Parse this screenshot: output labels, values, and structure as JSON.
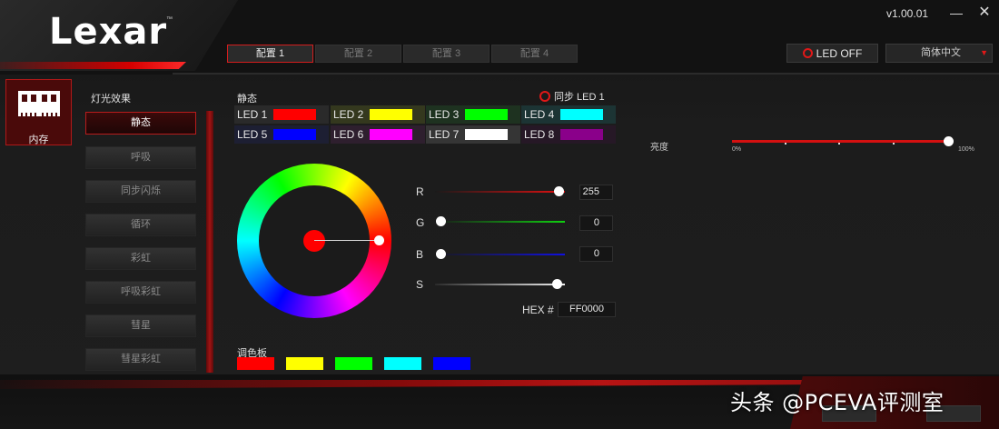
{
  "app": {
    "brand": "Lexar",
    "trademark": "™",
    "version": "v1.00.01",
    "window_min": "—",
    "window_close": "✕"
  },
  "tabs": [
    {
      "label": "配置 1",
      "active": true
    },
    {
      "label": "配置 2",
      "active": false
    },
    {
      "label": "配置 3",
      "active": false
    },
    {
      "label": "配置 4",
      "active": false
    }
  ],
  "header": {
    "led_off_label": "LED OFF",
    "language": "简体中文",
    "language_arrow": "▼"
  },
  "device": {
    "label": "内存",
    "icon": "ram-module-icon"
  },
  "effects": {
    "title": "灯光效果",
    "items": [
      {
        "label": "静态",
        "active": true
      },
      {
        "label": "呼吸",
        "active": false
      },
      {
        "label": "同步闪烁",
        "active": false
      },
      {
        "label": "循环",
        "active": false
      },
      {
        "label": "彩虹",
        "active": false
      },
      {
        "label": "呼吸彩虹",
        "active": false
      },
      {
        "label": "彗星",
        "active": false
      },
      {
        "label": "彗星彩虹",
        "active": false
      }
    ]
  },
  "static": {
    "title": "静态",
    "sync_label": "同步 LED 1",
    "leds": [
      {
        "label": "LED 1",
        "color": "#ff0000",
        "bg": "#2a2a2a"
      },
      {
        "label": "LED 2",
        "color": "#ffff00",
        "bg": "#34381e"
      },
      {
        "label": "LED 3",
        "color": "#00ff00",
        "bg": "#1e3220"
      },
      {
        "label": "LED 4",
        "color": "#00ffff",
        "bg": "#1c3434"
      },
      {
        "label": "LED 5",
        "color": "#0000ff",
        "bg": "#1d1f33"
      },
      {
        "label": "LED 6",
        "color": "#ff00ff",
        "bg": "#2e1f2e"
      },
      {
        "label": "LED 7",
        "color": "#ffffff",
        "bg": "#353535"
      },
      {
        "label": "LED 8",
        "color": "#8a008a",
        "bg": "#261826"
      }
    ]
  },
  "color": {
    "r_label": "R",
    "r_value": "255",
    "g_label": "G",
    "g_value": "0",
    "b_label": "B",
    "b_value": "0",
    "s_label": "S",
    "hex_label": "HEX #",
    "hex_value": "FF0000",
    "selected": "#ff0000"
  },
  "palette": {
    "title": "调色板",
    "colors": [
      "#ff0000",
      "#ffff00",
      "#00ff00",
      "#00ffff",
      "#0000ff"
    ]
  },
  "brightness": {
    "label": "亮度",
    "min_label": "0%",
    "max_label": "100%",
    "value": 100
  },
  "watermark": "头条 @PCEVA评测室"
}
